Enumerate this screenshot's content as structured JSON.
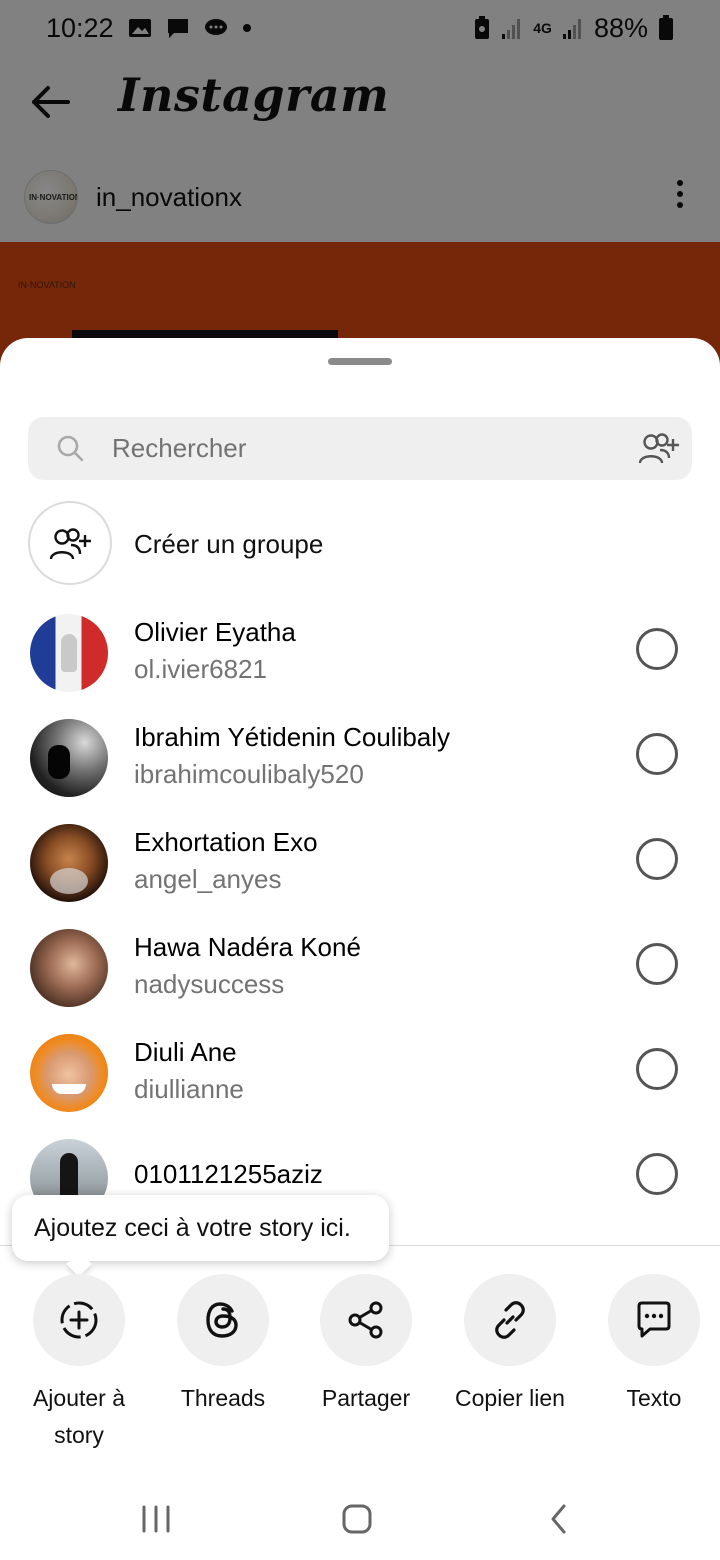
{
  "status_bar": {
    "time": "10:22",
    "battery": "88%",
    "network": "4G"
  },
  "header": {
    "app_title": "Instagram"
  },
  "post": {
    "username": "in_novationx"
  },
  "search": {
    "placeholder": "Rechercher"
  },
  "create_group": {
    "label": "Créer un groupe"
  },
  "contacts": [
    {
      "name": "Olivier Eyatha",
      "username": "ol.ivier6821",
      "selected": false
    },
    {
      "name": "Ibrahim Yétidenin Coulibaly",
      "username": "ibrahimcoulibaly520",
      "selected": false
    },
    {
      "name": "Exhortation Exo",
      "username": "angel_anyes",
      "selected": false
    },
    {
      "name": "Hawa Nadéra Koné",
      "username": "nadysuccess",
      "selected": false
    },
    {
      "name": "Diuli Ane",
      "username": "diullianne",
      "selected": false
    },
    {
      "name": "0101121255aziz",
      "username": "",
      "selected": false
    }
  ],
  "tooltip": {
    "text": "Ajoutez ceci à votre story ici."
  },
  "share_actions": [
    {
      "label_line1": "Ajouter à",
      "label_line2": "story",
      "icon": "add-to-story-icon"
    },
    {
      "label_line1": "Threads",
      "label_line2": "",
      "icon": "threads-icon"
    },
    {
      "label_line1": "Partager",
      "label_line2": "",
      "icon": "share-icon"
    },
    {
      "label_line1": "Copier lien",
      "label_line2": "",
      "icon": "link-icon"
    },
    {
      "label_line1": "Texto",
      "label_line2": "",
      "icon": "sms-icon"
    }
  ],
  "colors": {
    "sheet_background": "#ffffff",
    "secondary_text": "#737373",
    "search_background": "#efefef",
    "action_circle": "#efefef",
    "post_accent": "#e14a12"
  }
}
